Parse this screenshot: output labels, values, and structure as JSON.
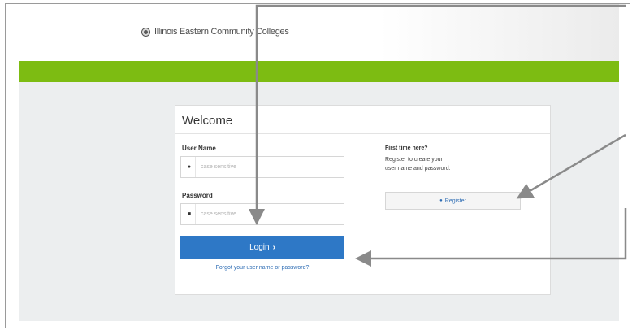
{
  "header": {
    "logo_text": "Illinois Eastern Community Colleges",
    "logo_icon": "college-seal-icon"
  },
  "login": {
    "title": "Welcome",
    "username_label": "User Name",
    "username_placeholder": "case sensitive",
    "username_icon": "user-icon",
    "password_label": "Password",
    "password_placeholder": "case sensitive",
    "password_icon": "lock-icon",
    "login_button": "Login",
    "login_button_icon": "chevron-right-icon",
    "forgot_link": "Forgot your user name or password?"
  },
  "first_time": {
    "title": "First time here?",
    "line1": "Register to create your",
    "line2": "user name and password.",
    "register_button": "Register",
    "register_icon": "user-icon"
  },
  "colors": {
    "brand_green": "#7dbc12",
    "login_blue": "#2e78c6",
    "callout_arrow": "#8a8a8a"
  }
}
